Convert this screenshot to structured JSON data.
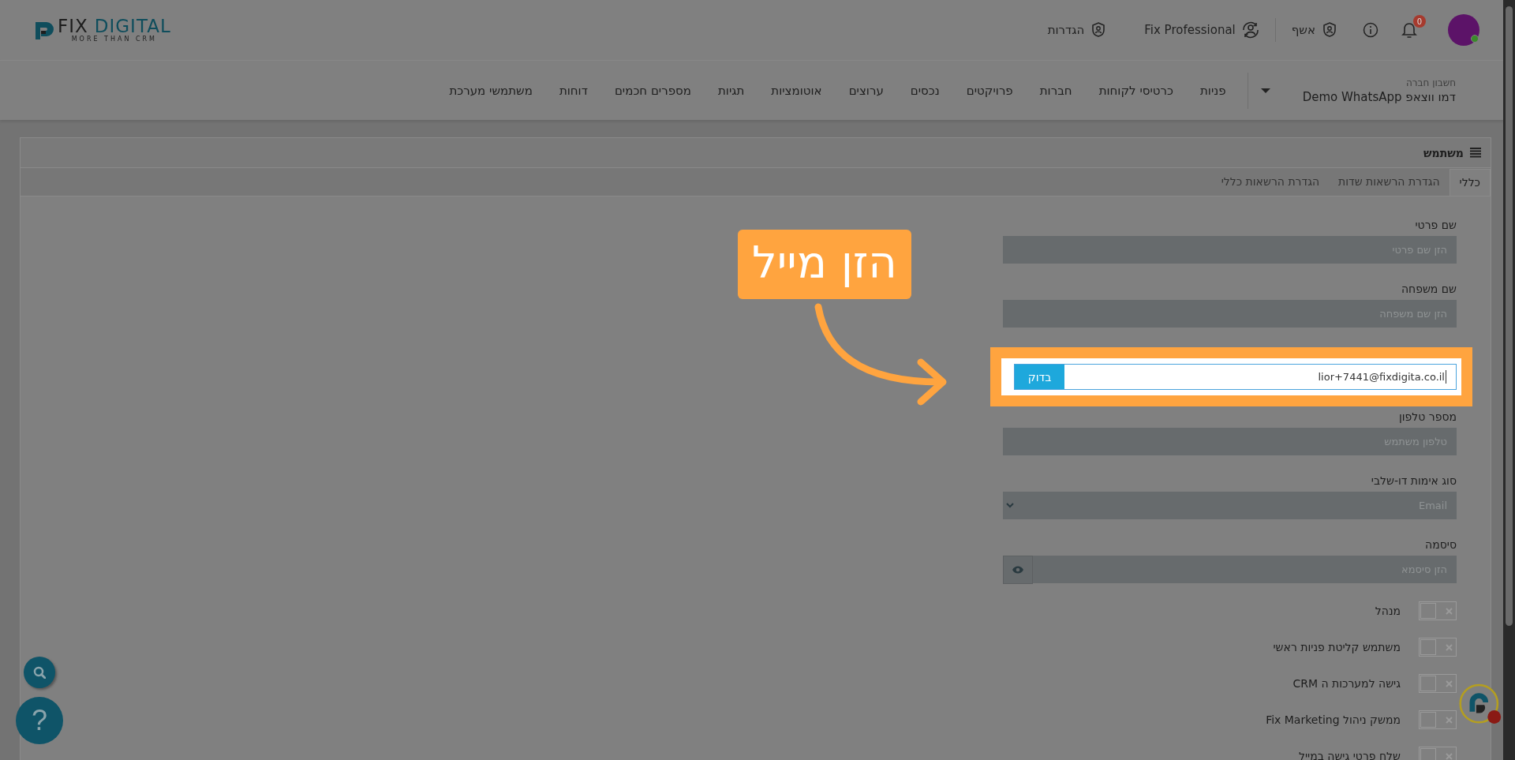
{
  "topbar": {
    "logo": {
      "word_1": "FIX",
      "word_2": "DIGITAL",
      "tagline": "MORE THAN CRM"
    },
    "items": [
      {
        "label": "אשף",
        "kind": "shield"
      },
      {
        "label": "Fix Professional",
        "kind": "switch-user"
      },
      {
        "label": "הגדרות",
        "kind": "shield"
      }
    ],
    "notifications": {
      "count": "0"
    },
    "avatar": {
      "online": true
    }
  },
  "navbar": {
    "company_label": "חשבון חברה",
    "company_name": "דמו ווצאפ Demo WhatsApp",
    "items": [
      "פניות",
      "כרטיסי לקוחות",
      "חברות",
      "פרויקטים",
      "נכסים",
      "ערוצים",
      "אוטומציות",
      "תגיות",
      "מספרים חכמים",
      "דוחות",
      "משתמשי מערכת"
    ]
  },
  "card": {
    "title": "משתמש",
    "tabs": [
      {
        "label": "כללי",
        "selected": true
      },
      {
        "label": "הגדרת הרשאות שדות",
        "selected": false
      },
      {
        "label": "הגדרת הרשאות כללי",
        "selected": false
      }
    ],
    "fields": [
      {
        "kind": "text",
        "label": "שם פרטי",
        "placeholder": "הזן שם פרטי"
      },
      {
        "kind": "text",
        "label": "שם משפחה",
        "placeholder": "הזן שם משפחה"
      },
      {
        "kind": "email",
        "value": "lior+7441@fixdigita.co.il",
        "button": "בדוק",
        "highlighted": true
      },
      {
        "kind": "text",
        "label": "מספר טלפון",
        "placeholder": "טלפון משתמש"
      },
      {
        "kind": "select",
        "label": "סוג אימות דו-שלבי",
        "value": "Email"
      },
      {
        "kind": "password",
        "label": "סיסמה",
        "placeholder": "הזן סיסמא"
      }
    ],
    "toggles": [
      {
        "label": "מנהל",
        "on": false
      },
      {
        "label": "משתמש קליטת פניות ראשי",
        "on": false
      },
      {
        "label": "גישה למערכות ה CRM",
        "on": false
      },
      {
        "label": "ממשק ניהול Fix Marketing",
        "on": false
      },
      {
        "label": "שלח פרטי גישה במייל",
        "on": false
      }
    ]
  },
  "callout": {
    "text": "הזן מייל"
  },
  "help_button": {
    "label": "?"
  }
}
